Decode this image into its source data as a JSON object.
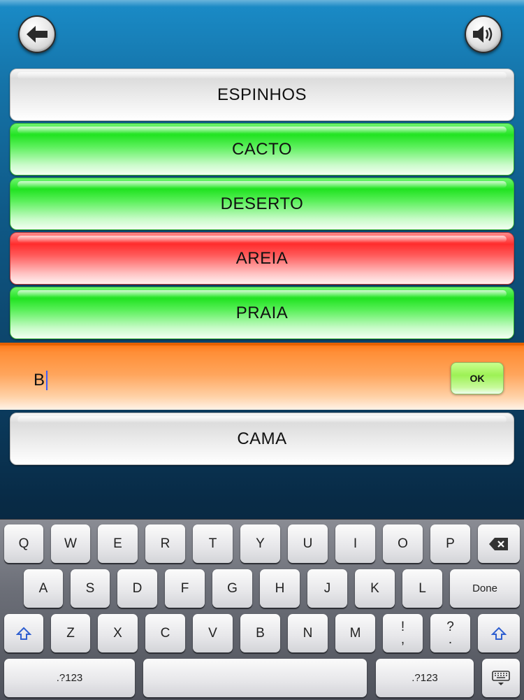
{
  "header": {
    "back_icon": "arrow-left-icon",
    "sound_icon": "speaker-icon"
  },
  "words_above": [
    {
      "label": "ESPINHOS",
      "state": "neutral"
    },
    {
      "label": "CACTO",
      "state": "correct"
    },
    {
      "label": "DESERTO",
      "state": "correct"
    },
    {
      "label": "AREIA",
      "state": "wrong"
    },
    {
      "label": "PRAIA",
      "state": "correct"
    }
  ],
  "answer": {
    "value": "B",
    "ok_label": "OK"
  },
  "words_below": [
    {
      "label": "CAMA",
      "state": "neutral"
    }
  ],
  "colors": {
    "correct": "#22e322",
    "wrong": "#ff2d2d",
    "neutral": "#dcdcdc",
    "input_bar": "#ff8e36",
    "ok_button": "#9df155"
  },
  "keyboard": {
    "row1": [
      "Q",
      "W",
      "E",
      "R",
      "T",
      "Y",
      "U",
      "I",
      "O",
      "P"
    ],
    "row2": [
      "A",
      "S",
      "D",
      "F",
      "G",
      "H",
      "J",
      "K",
      "L"
    ],
    "row3": [
      "Z",
      "X",
      "C",
      "V",
      "B",
      "N",
      "M"
    ],
    "punct1_top": "!",
    "punct1_bottom": ",",
    "punct2_top": "?",
    "punct2_bottom": ".",
    "done_label": "Done",
    "numbers_label": ".?123",
    "backspace_icon": "backspace-icon",
    "shift_icon": "shift-icon",
    "hide_keyboard_icon": "keyboard-hide-icon"
  }
}
